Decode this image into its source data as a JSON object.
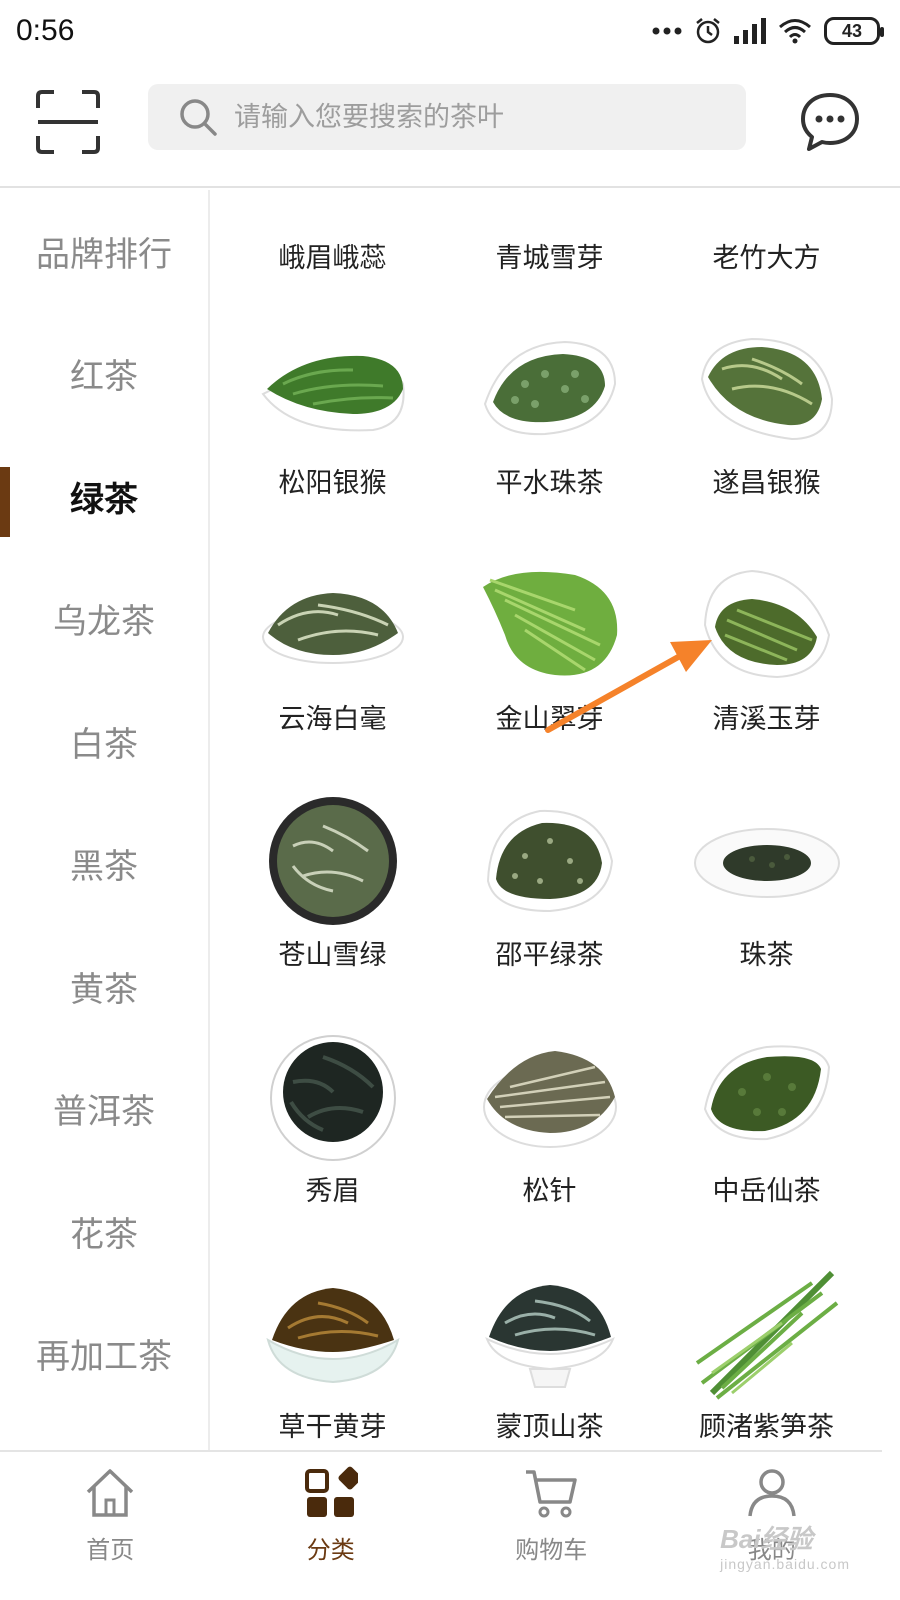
{
  "status_bar": {
    "time": "0:56",
    "battery": "43"
  },
  "search": {
    "placeholder": "请输入您要搜索的茶叶"
  },
  "sidebar": {
    "items": [
      {
        "label": "品牌排行"
      },
      {
        "label": "红茶"
      },
      {
        "label": "绿茶"
      },
      {
        "label": "乌龙茶"
      },
      {
        "label": "白茶"
      },
      {
        "label": "黑茶"
      },
      {
        "label": "黄茶"
      },
      {
        "label": "普洱茶"
      },
      {
        "label": "花茶"
      },
      {
        "label": "再加工茶"
      }
    ],
    "active": "绿茶"
  },
  "content": {
    "top_labels": [
      "峨眉峨蕊",
      "青城雪芽",
      "老竹大方"
    ],
    "items": [
      {
        "name": "松阳银猴"
      },
      {
        "name": "平水珠茶"
      },
      {
        "name": "遂昌银猴"
      },
      {
        "name": "云海白毫"
      },
      {
        "name": "金山翠芽"
      },
      {
        "name": "清溪玉芽"
      },
      {
        "name": "苍山雪绿"
      },
      {
        "name": "邵平绿茶"
      },
      {
        "name": "珠茶"
      },
      {
        "name": "秀眉"
      },
      {
        "name": "松针"
      },
      {
        "name": "中岳仙茶"
      },
      {
        "name": "草干黄芽"
      },
      {
        "name": "蒙顶山茶"
      },
      {
        "name": "顾渚紫笋茶"
      }
    ]
  },
  "bottom_nav": {
    "home": "首页",
    "category": "分类",
    "cart": "购物车",
    "mine": "我的"
  },
  "watermark": {
    "brand": "Bai经验",
    "url": "jingyan.baidu.com"
  },
  "colors": {
    "accent": "#6b3a12",
    "annotation": "#f5822a"
  }
}
